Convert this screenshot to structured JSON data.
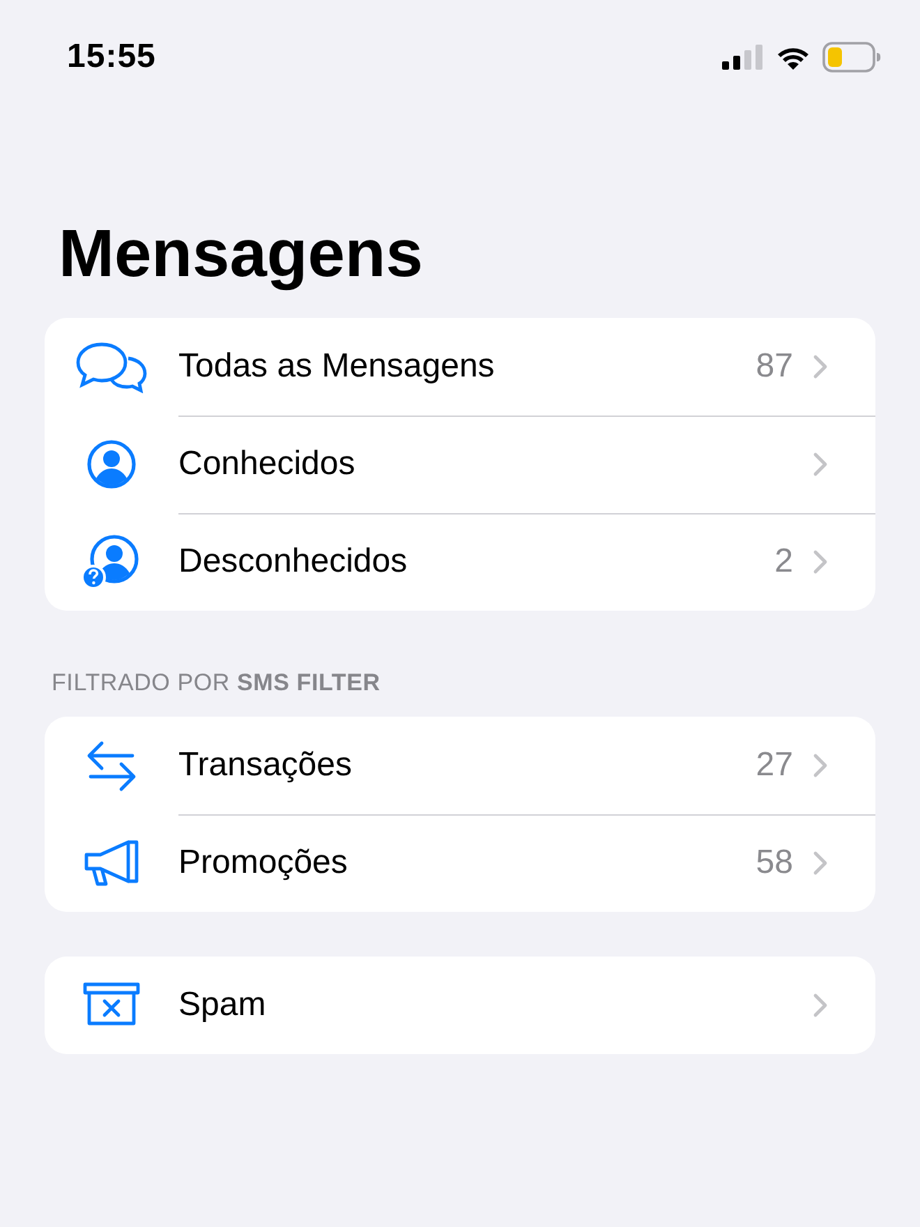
{
  "status_bar": {
    "time": "15:55"
  },
  "title": "Mensagens",
  "sections": [
    {
      "rows": [
        {
          "kind": "all",
          "label": "Todas as Mensagens",
          "count": "87"
        },
        {
          "kind": "known",
          "label": "Conhecidos"
        },
        {
          "kind": "unknown",
          "label": "Desconhecidos",
          "count": "2"
        }
      ]
    },
    {
      "header": "FILTRADO POR **SMS FILTER**",
      "rows": [
        {
          "kind": "transactions",
          "label": "Transações",
          "count": "27"
        },
        {
          "kind": "promotions",
          "label": "Promoções",
          "count": "58"
        }
      ]
    },
    {
      "rows": [
        {
          "kind": "spam",
          "label": "Spam"
        }
      ]
    }
  ]
}
